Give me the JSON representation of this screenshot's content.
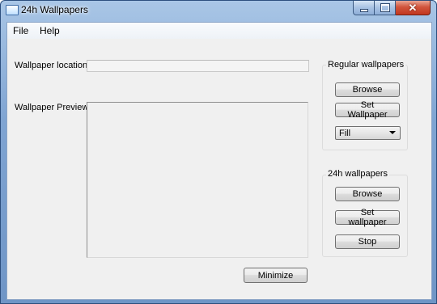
{
  "window": {
    "title": "24h Wallpapers"
  },
  "menu": {
    "items": [
      "File",
      "Help"
    ]
  },
  "labels": {
    "location": "Wallpaper location",
    "preview": "Wallpaper Preview"
  },
  "location_input": {
    "value": ""
  },
  "regular": {
    "title": "Regular wallpapers",
    "browse": "Browse",
    "set": "Set Wallpaper",
    "mode": "Fill"
  },
  "h24": {
    "title": "24h wallpapers",
    "browse": "Browse",
    "set": "Set wallpaper",
    "stop": "Stop"
  },
  "footer": {
    "minimize": "Minimize"
  },
  "colors": {
    "titlebar": "#7fa4d2",
    "close_button": "#c2371e",
    "client_bg": "#f0f0f0"
  }
}
